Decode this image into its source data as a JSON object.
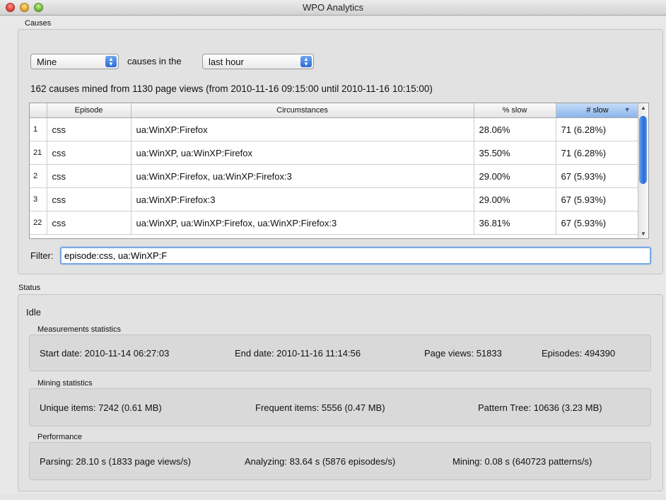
{
  "window": {
    "title": "WPO Analytics"
  },
  "causes": {
    "section_label": "Causes",
    "mode_select": "Mine",
    "causes_in_label": "causes in the",
    "period_select": "last hour",
    "summary": "162 causes mined from 1130 page views (from 2010-11-16 09:15:00 until 2010-11-16 10:15:00)",
    "table": {
      "headers": [
        "",
        "Episode",
        "Circumstances",
        "% slow",
        "# slow"
      ],
      "rows": [
        [
          "1",
          "css",
          "ua:WinXP:Firefox",
          "28.06%",
          "71 (6.28%)"
        ],
        [
          "21",
          "css",
          "ua:WinXP, ua:WinXP:Firefox",
          "35.50%",
          "71 (6.28%)"
        ],
        [
          "2",
          "css",
          "ua:WinXP:Firefox, ua:WinXP:Firefox:3",
          "29.00%",
          "67 (5.93%)"
        ],
        [
          "3",
          "css",
          "ua:WinXP:Firefox:3",
          "29.00%",
          "67 (5.93%)"
        ],
        [
          "22",
          "css",
          "ua:WinXP, ua:WinXP:Firefox, ua:WinXP:Firefox:3",
          "36.81%",
          "67 (5.93%)"
        ]
      ]
    },
    "filter_label": "Filter:",
    "filter_value": "episode:css, ua:WinXP:F"
  },
  "status": {
    "section_label": "Status",
    "state": "Idle",
    "measurements": {
      "label": "Measurements statistics",
      "start": "Start date:  2010-11-14 06:27:03",
      "end": "End date:  2010-11-16 11:14:56",
      "page_views": "Page views:  51833",
      "episodes": "Episodes:  494390"
    },
    "mining": {
      "label": "Mining statistics",
      "unique": "Unique items:  7242 (0.61 MB)",
      "frequent": "Frequent items:  5556 (0.47 MB)",
      "pattern_tree": "Pattern Tree:  10636 (3.23 MB)"
    },
    "performance": {
      "label": "Performance",
      "parsing": "Parsing:  28.10 s (1833 page views/s)",
      "analyzing": "Analyzing:  83.64 s (5876 episodes/s)",
      "mining": "Mining:  0.08 s (640723 patterns/s)"
    }
  }
}
